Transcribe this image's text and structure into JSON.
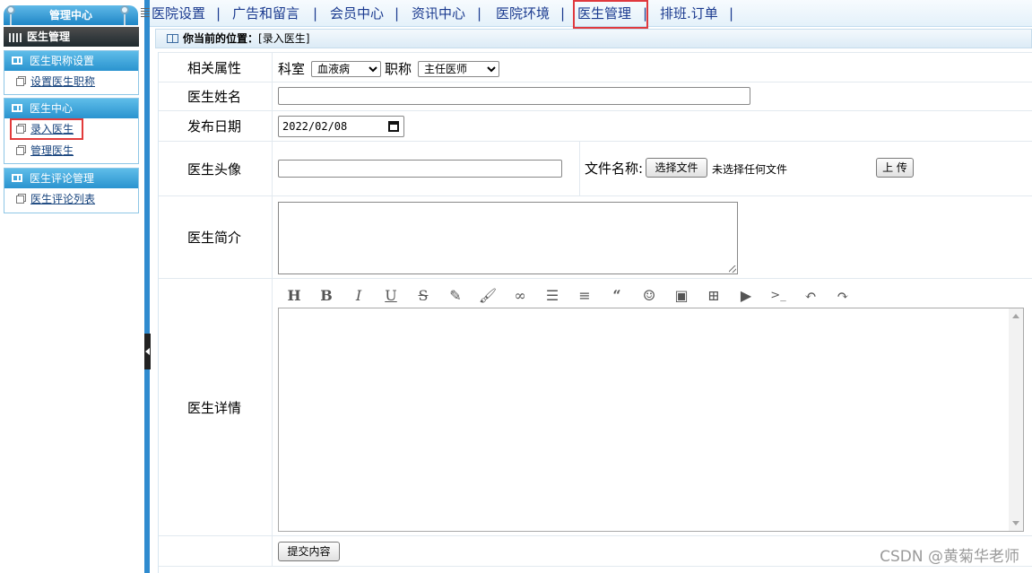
{
  "sidebar": {
    "title": "管理中心",
    "header": "医生管理",
    "groups": [
      {
        "title": "医生职称设置",
        "items": [
          "设置医生职称"
        ]
      },
      {
        "title": "医生中心",
        "items": [
          "录入医生",
          "管理医生"
        ]
      },
      {
        "title": "医生评论管理",
        "items": [
          "医生评论列表"
        ]
      }
    ]
  },
  "topnav": {
    "items": [
      "医院设置",
      "广告和留言",
      "会员中心",
      "资讯中心",
      "医院环境",
      "医生管理",
      "排班.订单"
    ],
    "separator": "|",
    "active": "医生管理"
  },
  "breadcrumb": {
    "label": "你当前的位置：",
    "value": "[录入医生]"
  },
  "form": {
    "attr_label": "相关属性",
    "dept_label": "科室",
    "dept_value": "血液病",
    "title_label": "职称",
    "title_value": "主任医师",
    "name_label": "医生姓名",
    "name_value": "",
    "date_label": "发布日期",
    "date_value": "2022/02/08",
    "avatar_label": "医生头像",
    "avatar_value": "",
    "file_label": "文件名称:",
    "choose_file": "选择文件",
    "no_file": "未选择任何文件",
    "upload": "上 传",
    "intro_label": "医生简介",
    "intro_value": "",
    "detail_label": "医生详情",
    "submit": "提交内容"
  },
  "editor_toolbar": [
    "heading-icon",
    "bold-icon",
    "italic-icon",
    "underline-icon",
    "strikethrough-icon",
    "highlight-icon",
    "brush-icon",
    "link-icon",
    "bulleted-list-icon",
    "align-icon",
    "quote-icon",
    "emoji-icon",
    "image-icon",
    "table-icon",
    "video-icon",
    "code-icon",
    "undo-icon",
    "redo-icon"
  ],
  "watermark": "CSDN @黄菊华老师",
  "colors": {
    "sidebar_blue": "#2a93cf",
    "nav_text": "#1a3a8f",
    "highlight_red": "#e0393e"
  }
}
